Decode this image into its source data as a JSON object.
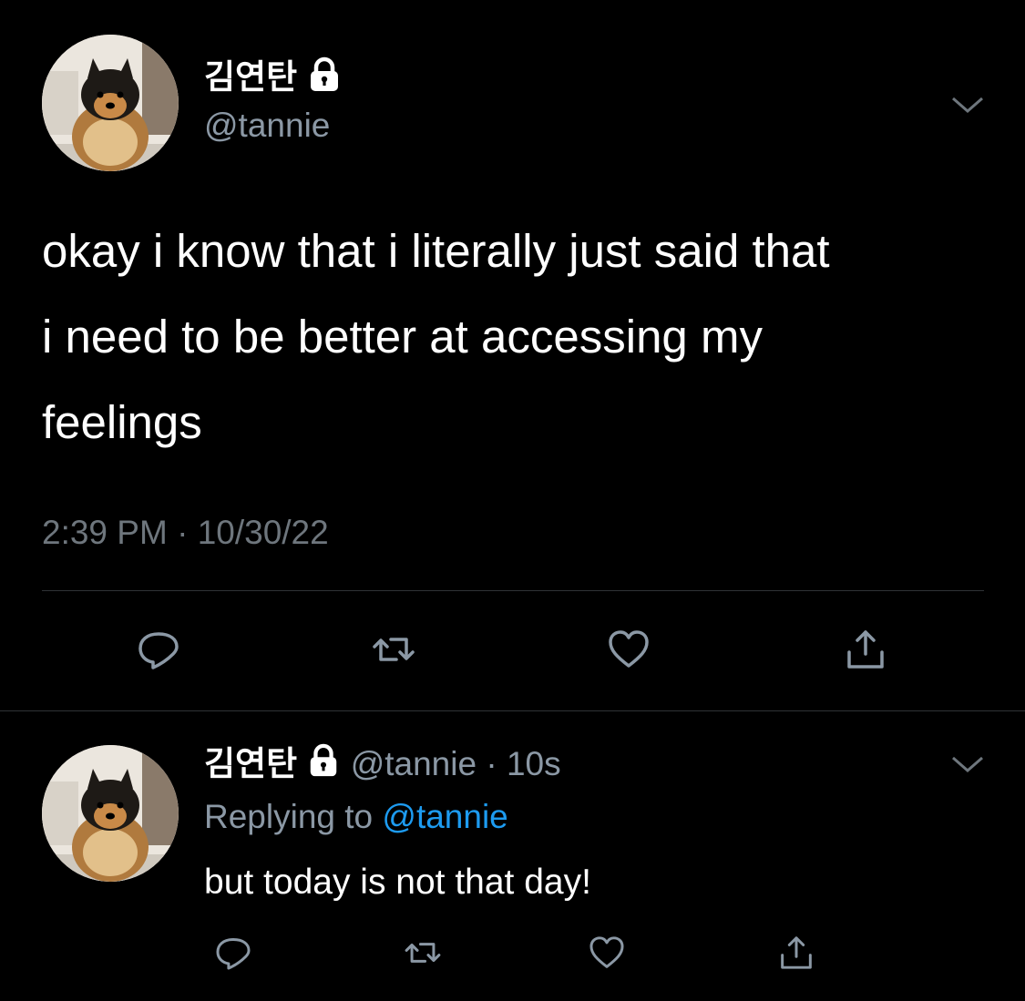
{
  "main_tweet": {
    "display_name": "김연탄",
    "handle": "@tannie",
    "text_line1": "okay i know that i literally just said that",
    "text_line2": "i need to be better at accessing my",
    "text_line3": "feelings",
    "time": "2:39 PM",
    "separator": " · ",
    "date": "10/30/22"
  },
  "reply_tweet": {
    "display_name": "김연탄",
    "handle": "@tannie",
    "separator": " · ",
    "age": "10s",
    "replying_prefix": "Replying to ",
    "replying_handle": "@tannie",
    "text": "but today is not that day!"
  },
  "icons": {
    "lock": "lock-icon",
    "more": "chevron-down-icon",
    "reply": "comment-bubble-icon",
    "retweet": "retweet-icon",
    "like": "heart-icon",
    "share": "share-icon"
  },
  "colors": {
    "background": "#000000",
    "text_primary": "#ffffff",
    "text_secondary": "#8b98a5",
    "icon_gray": "#6e767d",
    "link_blue": "#1d9bf0",
    "divider": "#2f3336"
  }
}
